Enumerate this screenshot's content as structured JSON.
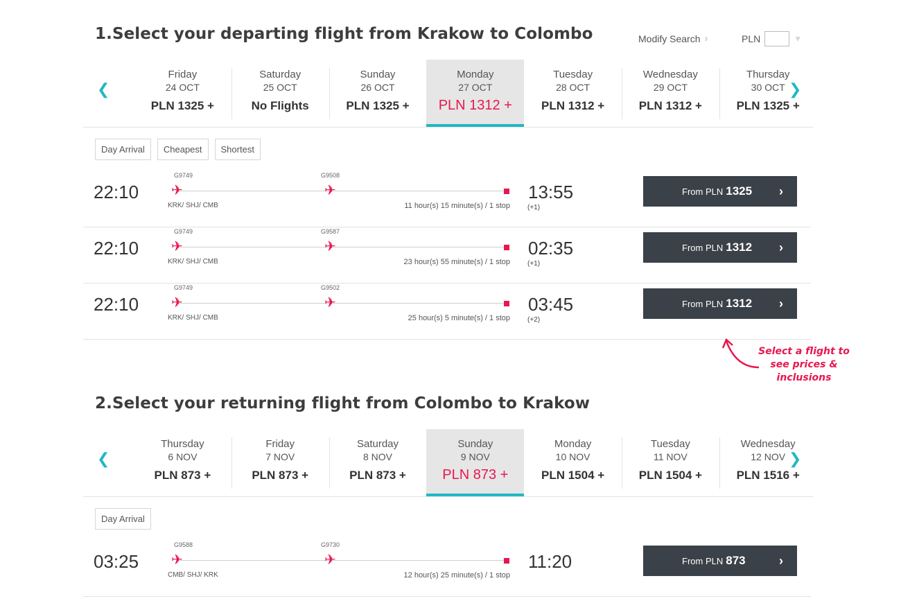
{
  "outbound": {
    "title": "1.Select your departing flight from Krakow to Colombo",
    "modify_label": "Modify Search",
    "currency_label": "PLN",
    "days": [
      {
        "name": "Friday",
        "date": "24 OCT",
        "price": "PLN 1325 +",
        "selected": false
      },
      {
        "name": "Saturday",
        "date": "25 OCT",
        "price": "No Flights",
        "selected": false
      },
      {
        "name": "Sunday",
        "date": "26 OCT",
        "price": "PLN 1325 +",
        "selected": false
      },
      {
        "name": "Monday",
        "date": "27 OCT",
        "price": "PLN 1312 +",
        "selected": true
      },
      {
        "name": "Tuesday",
        "date": "28 OCT",
        "price": "PLN 1312 +",
        "selected": false
      },
      {
        "name": "Wednesday",
        "date": "29 OCT",
        "price": "PLN 1312 +",
        "selected": false
      },
      {
        "name": "Thursday",
        "date": "30 OCT",
        "price": "PLN 1325 +",
        "selected": false
      }
    ],
    "filters": [
      "Day Arrival",
      "Cheapest",
      "Shortest"
    ],
    "flights": [
      {
        "dep": "22:10",
        "leg1": "G9749",
        "leg2": "G9508",
        "codes": "KRK/ SHJ/ CMB",
        "duration": "11 hour(s) 15 minute(s) / 1 stop",
        "arr": "13:55",
        "plus": "(+1)",
        "from": "From PLN",
        "price": "1325"
      },
      {
        "dep": "22:10",
        "leg1": "G9749",
        "leg2": "G9587",
        "codes": "KRK/ SHJ/ CMB",
        "duration": "23 hour(s) 55 minute(s) / 1 stop",
        "arr": "02:35",
        "plus": "(+1)",
        "from": "From PLN",
        "price": "1312"
      },
      {
        "dep": "22:10",
        "leg1": "G9749",
        "leg2": "G9502",
        "codes": "KRK/ SHJ/ CMB",
        "duration": "25 hour(s) 5 minute(s) / 1 stop",
        "arr": "03:45",
        "plus": "(+2)",
        "from": "From PLN",
        "price": "1312"
      }
    ]
  },
  "hint": {
    "line1": "Select a flight to",
    "line2": "see prices &",
    "line3": "inclusions"
  },
  "return": {
    "title": "2.Select your returning flight from Colombo to Krakow",
    "days": [
      {
        "name": "Thursday",
        "date": "6 NOV",
        "price": "PLN 873 +",
        "selected": false
      },
      {
        "name": "Friday",
        "date": "7 NOV",
        "price": "PLN 873 +",
        "selected": false
      },
      {
        "name": "Saturday",
        "date": "8 NOV",
        "price": "PLN 873 +",
        "selected": false
      },
      {
        "name": "Sunday",
        "date": "9 NOV",
        "price": "PLN 873 +",
        "selected": true
      },
      {
        "name": "Monday",
        "date": "10 NOV",
        "price": "PLN 1504 +",
        "selected": false
      },
      {
        "name": "Tuesday",
        "date": "11 NOV",
        "price": "PLN 1504 +",
        "selected": false
      },
      {
        "name": "Wednesday",
        "date": "12 NOV",
        "price": "PLN 1516 +",
        "selected": false
      }
    ],
    "filters": [
      "Day Arrival"
    ],
    "flights": [
      {
        "dep": "03:25",
        "leg1": "G9588",
        "leg2": "G9730",
        "codes": "CMB/ SHJ/ KRK",
        "duration": "12 hour(s) 25 minute(s) / 1 stop",
        "arr": "11:20",
        "plus": "",
        "from": "From PLN",
        "price": "873"
      }
    ]
  },
  "colors": {
    "accent": "#e8174f",
    "teal": "#1fb8c4",
    "button": "#3b4148"
  },
  "icons": {
    "prev": "chevron-left-icon",
    "next": "chevron-right-icon",
    "plane": "plane-icon",
    "dropdown": "chevron-down-icon"
  }
}
